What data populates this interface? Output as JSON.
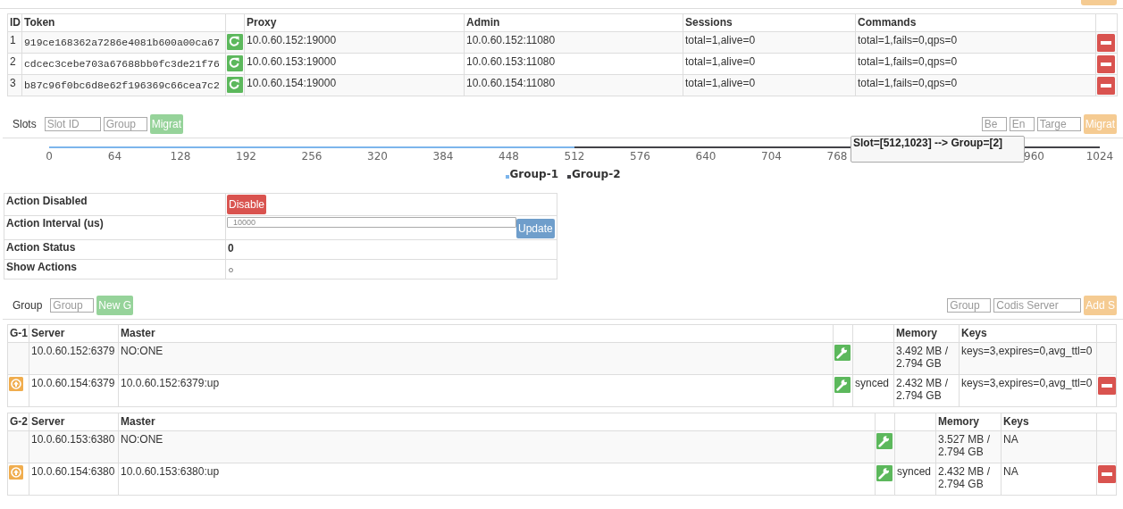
{
  "top_button": {
    "kind": "warning"
  },
  "proxies": {
    "columns": [
      "ID",
      "Token",
      "Proxy",
      "Admin",
      "Sessions",
      "Commands"
    ],
    "rows": [
      {
        "id": "1",
        "token": "919ce168362a7286e4081b600a00ca67",
        "proxy": "10.0.60.152:19000",
        "admin": "10.0.60.152:11080",
        "sessions": "total=1,alive=0",
        "commands": "total=1,fails=0,qps=0"
      },
      {
        "id": "2",
        "token": "cdcec3cebe703a67688bb0fc3de21f76",
        "proxy": "10.0.60.153:19000",
        "admin": "10.0.60.153:11080",
        "sessions": "total=1,alive=0",
        "commands": "total=1,fails=0,qps=0"
      },
      {
        "id": "3",
        "token": "b87c96f0bc6d8e62f196369c66cea7c2",
        "proxy": "10.0.60.154:19000",
        "admin": "10.0.60.154:11080",
        "sessions": "total=1,alive=0",
        "commands": "total=1,fails=0,qps=0"
      }
    ]
  },
  "slots_toolbar": {
    "label": "Slots",
    "fields": [
      {
        "placeholder": "Slot ID"
      },
      {
        "placeholder": "Group"
      }
    ],
    "button": {
      "label": "Migrat",
      "kind": "success"
    },
    "right_fields": [
      {
        "placeholder": "Be"
      },
      {
        "placeholder": "En"
      },
      {
        "placeholder": "Targe"
      }
    ],
    "right_button": {
      "label": "Migrat",
      "kind": "warning"
    }
  },
  "slots": {
    "axis_labels": [
      "0",
      "64",
      "128",
      "192",
      "256",
      "320",
      "384",
      "448",
      "512",
      "576",
      "640",
      "704",
      "768",
      "960",
      "1024"
    ],
    "segments": [
      {
        "name": "Group-1",
        "color": "#7cb5ec"
      },
      {
        "name": "Group-2",
        "color": "#434348"
      }
    ],
    "tooltip": "Slot=[512,1023] --> Group=[2]"
  },
  "actions": [
    {
      "label": "Action Disabled",
      "kind": "button",
      "button": "Disable"
    },
    {
      "label": "Action Interval (us)",
      "kind": "input",
      "value": "10000",
      "button": "Update"
    },
    {
      "label": "Action Status",
      "kind": "text",
      "value": "0"
    },
    {
      "label": "Show Actions",
      "kind": "checkbox",
      "checked": false
    }
  ],
  "group_toolbar": {
    "label": "Group",
    "fields": [
      {
        "placeholder": "Group"
      }
    ],
    "button": {
      "label": "New G",
      "kind": "success"
    },
    "right_fields": [
      {
        "placeholder": "Group"
      },
      {
        "placeholder": "Codis Server"
      }
    ],
    "right_button": {
      "label": "Add S",
      "kind": "warning"
    }
  },
  "groups": [
    {
      "id": "G-1",
      "columns": [
        "Server",
        "Master",
        "Memory",
        "Keys"
      ],
      "servers": [
        {
          "server": "10.0.60.152:6379",
          "master": "NO:ONE",
          "memory": "3.492 MB / 2.794 GB",
          "keys": "keys=3,expires=0,avg_ttl=0",
          "promotable": false,
          "removable": false
        },
        {
          "server": "10.0.60.154:6379",
          "master": "10.0.60.152:6379:up",
          "status": "synced",
          "memory": "2.432 MB / 2.794 GB",
          "keys": "keys=3,expires=0,avg_ttl=0",
          "promotable": true,
          "removable": true
        }
      ]
    },
    {
      "id": "G-2",
      "columns": [
        "Server",
        "Master",
        "Memory",
        "Keys"
      ],
      "servers": [
        {
          "server": "10.0.60.153:6380",
          "master": "NO:ONE",
          "memory": "3.527 MB / 2.794 GB",
          "keys": "NA",
          "promotable": false,
          "removable": false
        },
        {
          "server": "10.0.60.154:6380",
          "master": "10.0.60.153:6380:up",
          "status": "synced",
          "memory": "2.432 MB / 2.794 GB",
          "keys": "NA",
          "promotable": true,
          "removable": true
        }
      ]
    }
  ]
}
